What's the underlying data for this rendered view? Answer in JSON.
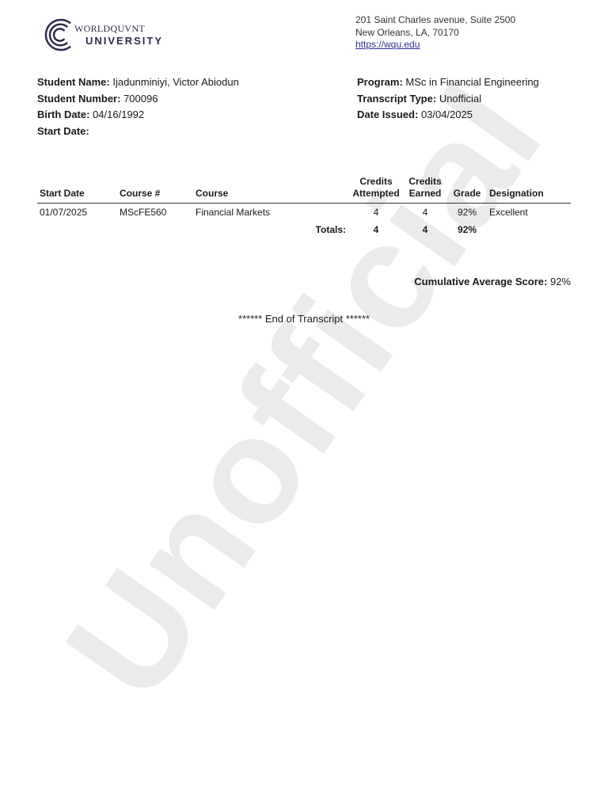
{
  "watermark": "Unofficial",
  "institution": {
    "logo_line1": "WORLDQUVNT",
    "logo_line2": "UNIVERSITY",
    "address_line1": "201 Saint Charles avenue, Suite 2500",
    "address_line2": "New Orleans, LA, 70170",
    "website": "https://wqu.edu"
  },
  "student": {
    "name_label": "Student Name:",
    "name": "Ijadunminiyi, Victor Abiodun",
    "number_label": "Student Number:",
    "number": "700096",
    "birth_label": "Birth Date:",
    "birth": "04/16/1992",
    "start_label": "Start Date:",
    "start": ""
  },
  "program": {
    "program_label": "Program:",
    "program": "MSc in Financial Engineering",
    "type_label": "Transcript Type:",
    "type": "Unofficial",
    "issued_label": "Date Issued:",
    "issued": "03/04/2025"
  },
  "table": {
    "headers": {
      "start_date": "Start Date",
      "course_num": "Course #",
      "course": "Course",
      "credits_att_1": "Credits",
      "credits_att_2": "Attempted",
      "credits_earn_1": "Credits",
      "credits_earn_2": "Earned",
      "grade": "Grade",
      "designation": "Designation"
    },
    "rows": [
      {
        "start_date": "01/07/2025",
        "course_num": "MScFE560",
        "course": "Financial Markets",
        "credits_attempted": "4",
        "credits_earned": "4",
        "grade": "92%",
        "designation": "Excellent"
      }
    ],
    "totals": {
      "label": "Totals:",
      "credits_attempted": "4",
      "credits_earned": "4",
      "grade": "92%"
    }
  },
  "cumulative": {
    "label": "Cumulative Average Score:",
    "value": "92%"
  },
  "end_text": "****** End of Transcript ******",
  "colors": {
    "brand": "#2c2a4a",
    "link": "#2a2f8f",
    "text": "#1a1a1a"
  }
}
